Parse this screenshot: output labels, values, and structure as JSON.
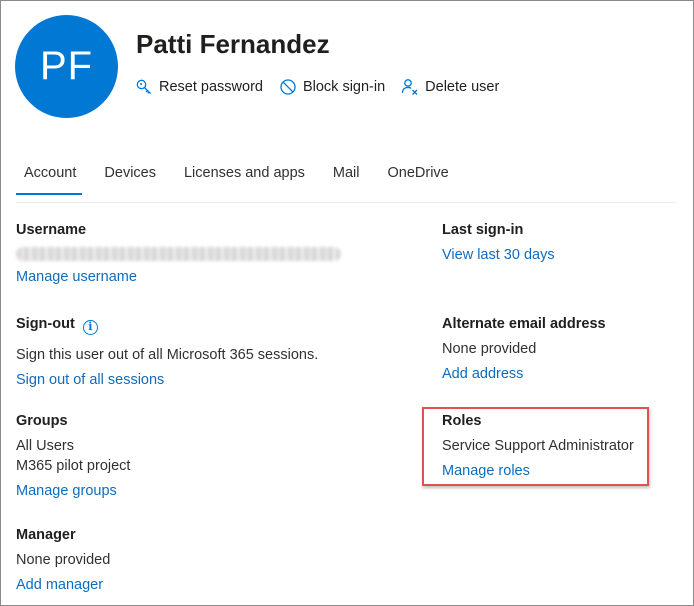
{
  "user": {
    "initials": "PF",
    "name": "Patti Fernandez",
    "avatar_color": "#0078d4"
  },
  "actions": [
    {
      "icon": "key-icon",
      "label": "Reset password"
    },
    {
      "icon": "block-icon",
      "label": "Block sign-in"
    },
    {
      "icon": "delete-user-icon",
      "label": "Delete user"
    }
  ],
  "tabs": [
    {
      "label": "Account",
      "active": true
    },
    {
      "label": "Devices",
      "active": false
    },
    {
      "label": "Licenses and apps",
      "active": false
    },
    {
      "label": "Mail",
      "active": false
    },
    {
      "label": "OneDrive",
      "active": false
    }
  ],
  "username": {
    "label": "Username",
    "link": "Manage username"
  },
  "last_signin": {
    "label": "Last sign-in",
    "link": "View last 30 days"
  },
  "signout": {
    "label": "Sign-out",
    "description": "Sign this user out of all Microsoft 365 sessions.",
    "link": "Sign out of all sessions"
  },
  "alternate_email": {
    "label": "Alternate email address",
    "value": "None provided",
    "link": "Add address"
  },
  "groups": {
    "label": "Groups",
    "items": [
      "All Users",
      "M365 pilot project"
    ],
    "link": "Manage groups"
  },
  "roles": {
    "label": "Roles",
    "value": "Service Support Administrator",
    "link": "Manage roles"
  },
  "manager": {
    "label": "Manager",
    "value": "None provided",
    "link": "Add manager"
  },
  "colors": {
    "accent": "#0078d4",
    "link": "#0f6cbd",
    "highlight": "#e05252"
  }
}
